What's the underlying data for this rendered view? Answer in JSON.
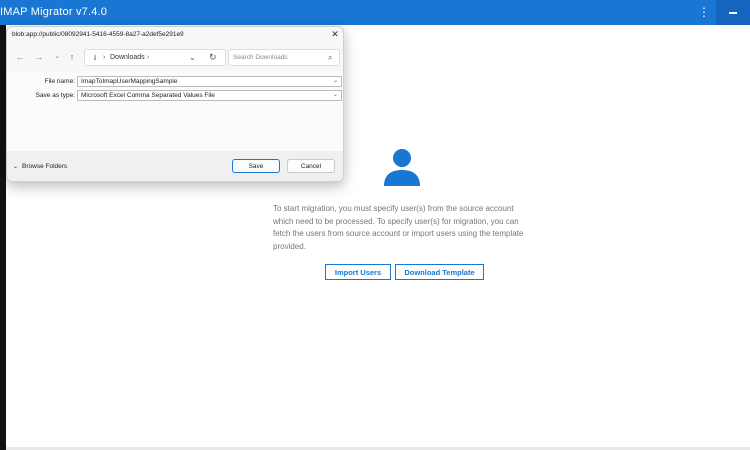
{
  "app": {
    "title": "IMAP Migrator v7.4.0",
    "menu_icon": "kebab-menu-icon",
    "minimize_icon": "minimize-icon",
    "accent_color": "#1976d2"
  },
  "main": {
    "empty_icon": "person-icon",
    "message": "To start migration, you must specify user(s) from the source account which need to be processed. To specify user(s) for migration, you can fetch the users from source account or import users using the template provided.",
    "import_label": "Import Users",
    "template_label": "Download Template"
  },
  "dialog": {
    "title": "blob:app://public/08092941-5416-4559-8a27-a2def5e291e9",
    "nav": {
      "location_icon": "download-icon",
      "location": "Downloads",
      "search_placeholder": "Search Downloads"
    },
    "file_name_label": "File name:",
    "file_name_value": "ImapToImapUserMappingSample",
    "save_type_label": "Save as type:",
    "save_type_value": "Microsoft Excel Comma Separated Values File",
    "browse_label": "Browse Folders",
    "save_label": "Save",
    "cancel_label": "Cancel"
  }
}
